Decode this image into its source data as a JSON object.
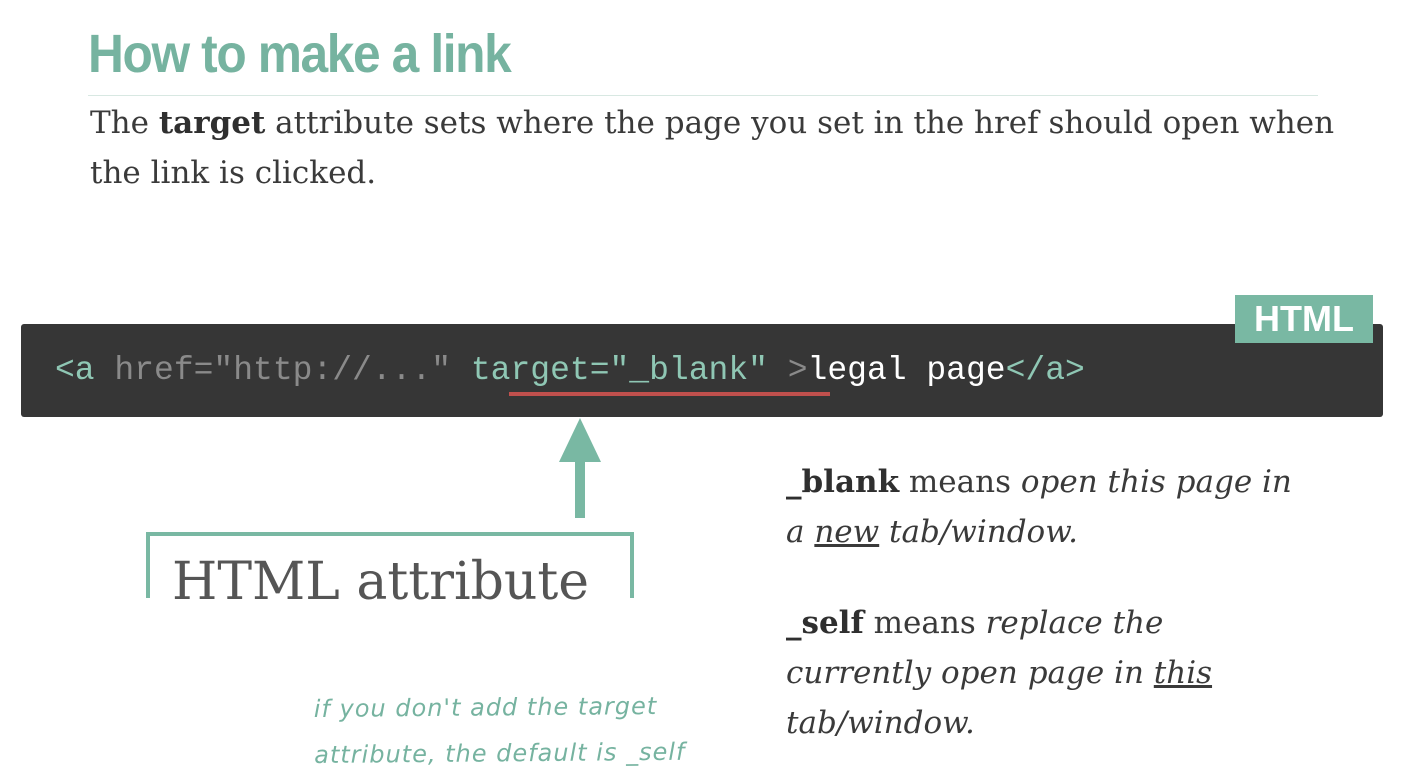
{
  "title": "How to make a link",
  "intro": {
    "before": "The ",
    "keyword": "target",
    "after": " attribute sets where the page you set in the href should open when the link is clicked."
  },
  "code": {
    "language_badge": "HTML",
    "open_tag": "<a",
    "href_attr": " href=\"http://...\" ",
    "target_attr": "target=\"_blank\"",
    "close_bracket": " >",
    "link_text": "legal page",
    "end_tag": "</a>"
  },
  "annotation": {
    "label": "HTML attribute"
  },
  "blank_explain": {
    "keyword": "_blank",
    "means": " means ",
    "italic_1": "open this page in a ",
    "underlined": "new",
    "italic_2": " tab/window."
  },
  "self_explain": {
    "keyword": "_self",
    "means": " means ",
    "italic_1": "replace the currently open page in ",
    "underlined": "this",
    "italic_2": " tab/window."
  },
  "handwritten_note": {
    "line1": "if you don't add the target",
    "line2": "attribute, the default is _self"
  },
  "colors": {
    "accent": "#79b8a3",
    "code_bg": "#363636",
    "underline": "#c0504d"
  }
}
